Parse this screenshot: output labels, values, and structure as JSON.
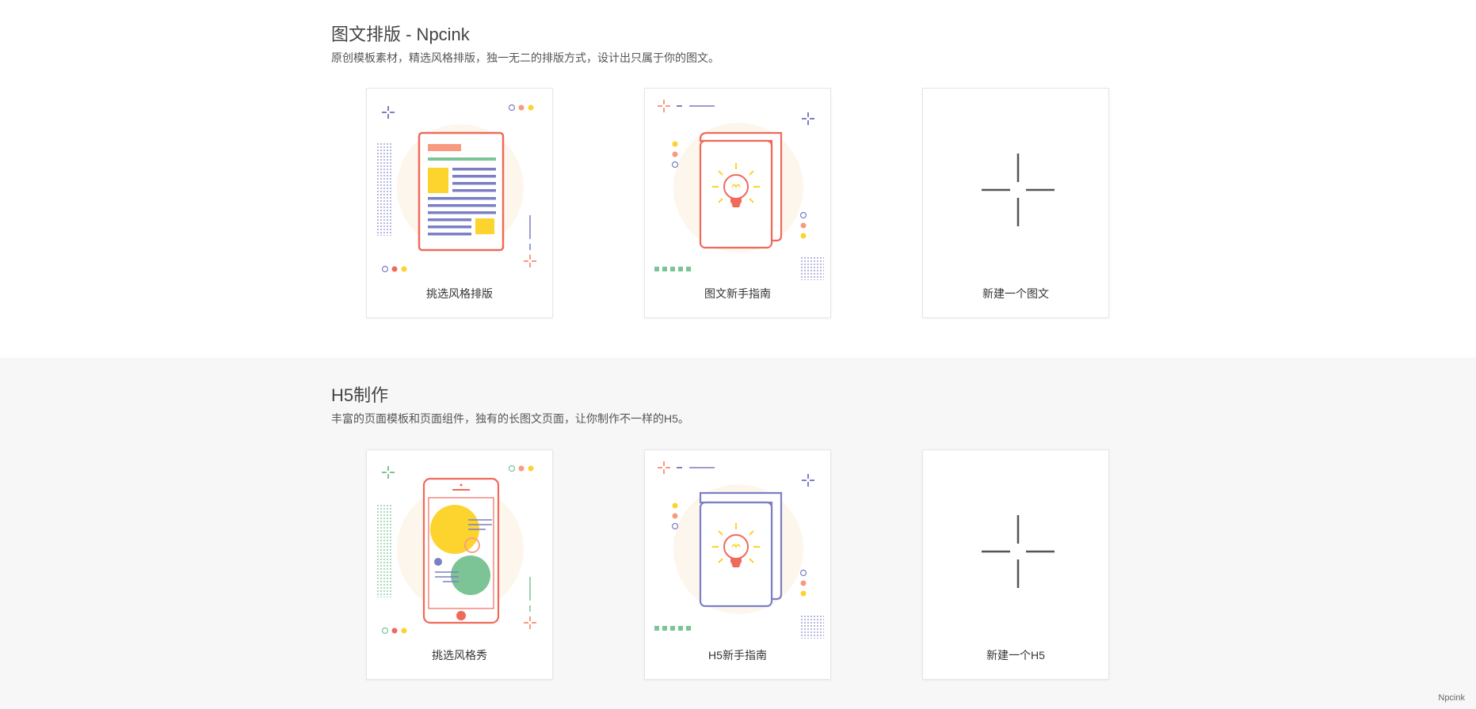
{
  "sections": [
    {
      "title": "图文排版 - Npcink",
      "description": "原创模板素材，精选风格排版，独一无二的排版方式，设计出只属于你的图文。",
      "cards": [
        {
          "label": "挑选风格排版",
          "icon": "document-layout-icon"
        },
        {
          "label": "图文新手指南",
          "icon": "guide-book-icon"
        },
        {
          "label": "新建一个图文",
          "icon": "plus-icon"
        }
      ]
    },
    {
      "title": "H5制作",
      "description": "丰富的页面模板和页面组件，独有的长图文页面，让你制作不一样的H5。",
      "cards": [
        {
          "label": "挑选风格秀",
          "icon": "phone-template-icon"
        },
        {
          "label": "H5新手指南",
          "icon": "guide-book-icon"
        },
        {
          "label": "新建一个H5",
          "icon": "plus-icon"
        }
      ]
    }
  ],
  "footer": {
    "brand": "Npcink"
  },
  "colors": {
    "coral": "#ef6a5a",
    "salmon": "#f79a80",
    "purple": "#7b7fc4",
    "yellow": "#fdd32d",
    "green": "#7cc496",
    "glow": "#fdf6ec",
    "plus": "#555555"
  }
}
